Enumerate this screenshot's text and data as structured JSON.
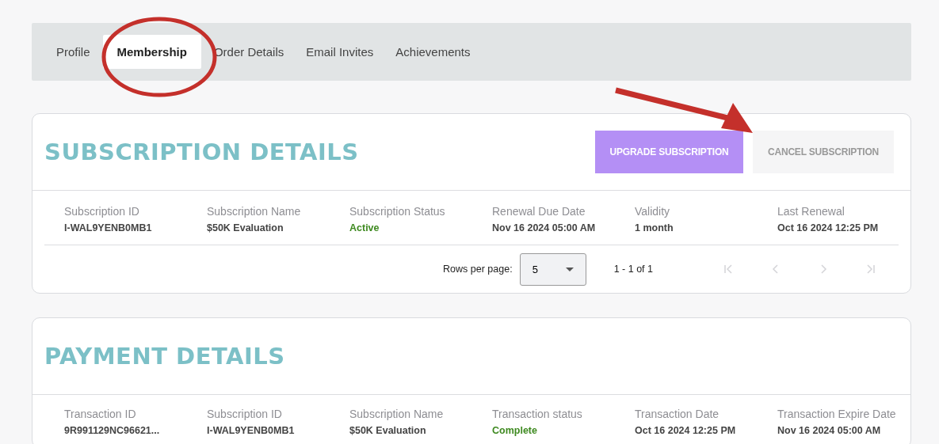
{
  "tabs": [
    {
      "label": "Profile",
      "selected": false
    },
    {
      "label": "Membership",
      "selected": true
    },
    {
      "label": "Order Details",
      "selected": false
    },
    {
      "label": "Email Invites",
      "selected": false
    },
    {
      "label": "Achievements",
      "selected": false
    }
  ],
  "subscription": {
    "title": "SUBSCRIPTION DETAILS",
    "buttons": [
      {
        "label": "UPGRADE SUBSCRIPTION",
        "kind": "primary"
      },
      {
        "label": "CANCEL SUBSCRIPTION",
        "kind": "secondary"
      }
    ],
    "columns": [
      {
        "label": "Subscription ID",
        "value": "I-WAL9YENB0MB1",
        "kind": "text"
      },
      {
        "label": "Subscription Name",
        "value": "$50K Evaluation",
        "kind": "text"
      },
      {
        "label": "Subscription Status",
        "value": "Active",
        "kind": "status"
      },
      {
        "label": "Renewal Due Date",
        "value": "Nov 16 2024 05:00 AM",
        "kind": "text"
      },
      {
        "label": "Validity",
        "value": "1 month",
        "kind": "text"
      },
      {
        "label": "Last Renewal",
        "value": "Oct 16 2024 12:25 PM",
        "kind": "text"
      }
    ],
    "pagination": {
      "rows_label": "Rows per page:",
      "rows_value": "5",
      "range": "1 - 1 of 1",
      "buttons": [
        {
          "kind": "first",
          "disabled": true
        },
        {
          "kind": "prev",
          "disabled": true
        },
        {
          "kind": "next",
          "disabled": true
        },
        {
          "kind": "last",
          "disabled": true
        }
      ]
    }
  },
  "payment": {
    "title": "PAYMENT DETAILS",
    "columns": [
      {
        "label": "Transaction ID",
        "value": "9R991129NC96621...",
        "kind": "text"
      },
      {
        "label": "Subscription ID",
        "value": "I-WAL9YENB0MB1",
        "kind": "text"
      },
      {
        "label": "Subscription Name",
        "value": "$50K Evaluation",
        "kind": "text"
      },
      {
        "label": "Transaction status",
        "value": "Complete",
        "kind": "status"
      },
      {
        "label": "Transaction Date",
        "value": "Oct 16 2024 12:25 PM",
        "kind": "text"
      },
      {
        "label": "Transaction Expire Date",
        "value": "Nov 16 2024 05:00 AM",
        "kind": "text"
      }
    ]
  }
}
